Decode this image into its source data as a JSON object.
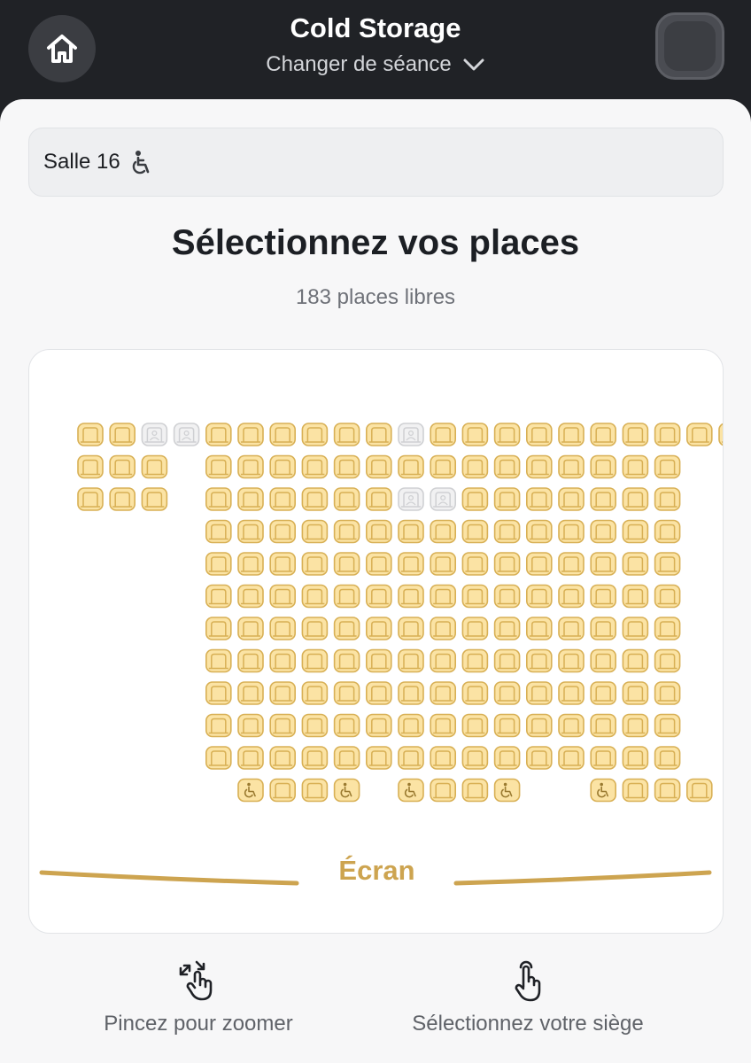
{
  "header": {
    "title": "Cold Storage",
    "session_label": "Changer de séance",
    "home_icon": "home-icon",
    "menu_icon": "menu-icon"
  },
  "room": {
    "label": "Salle 16",
    "accessible_icon": "wheelchair-icon"
  },
  "main": {
    "heading": "Sélectionnez vos places",
    "free_seats": "183 places libres"
  },
  "seat_map": {
    "screen_label": "Écran",
    "seat_types": {
      "A": "available",
      "U": "unavailable",
      "W": "wheelchair",
      "_": "no-seat"
    },
    "rows": [
      "AAUUAAAAAAUAAAAAAAAAA",
      "AAA_AAAAAAAAAAAAAAA__",
      "AAA_AAAAAAUUAAAAAAA__",
      "____AAAAAAAAAAAAAAA__",
      "____AAAAAAAAAAAAAAA__",
      "____AAAAAAAAAAAAAAA__",
      "____AAAAAAAAAAAAAAA__",
      "____AAAAAAAAAAAAAAA__",
      "____AAAAAAAAAAAAAAA__",
      "____AAAAAAAAAAAAAAA__",
      "____AAAAAAAAAAAAAAA__",
      "_____WAAW_WAAW__WAAA_"
    ],
    "colors": {
      "available_fill": "#fbe3a4",
      "available_stroke": "#d8b055",
      "unavailable_fill": "#f1f1f2",
      "unavailable_stroke": "#cfd0d3",
      "screen": "#cda450"
    }
  },
  "hints": {
    "zoom_label": "Pincez pour zoomer",
    "zoom_icon": "pinch-zoom-icon",
    "select_label": "Sélectionnez votre siège",
    "select_icon": "tap-icon"
  }
}
